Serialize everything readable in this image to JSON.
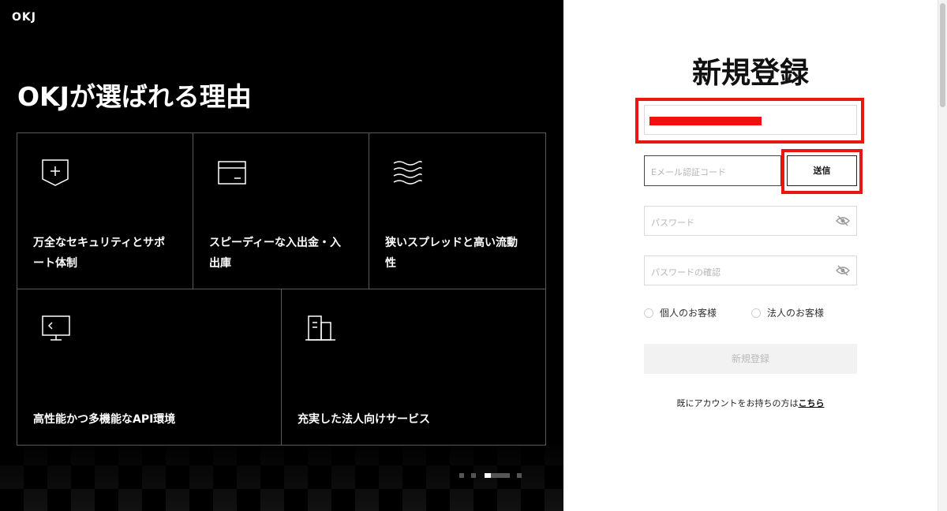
{
  "brand": {
    "logo": "OKJ"
  },
  "hero": {
    "title": "OKJが選ばれる理由",
    "features": [
      {
        "icon": "shield-plus-icon",
        "label_line1": "万全なセキュリティとサポ",
        "label_line2": "ート体制"
      },
      {
        "icon": "card-icon",
        "label_line1": "スピーディーな入出金・入",
        "label_line2": "出庫"
      },
      {
        "icon": "waves-icon",
        "label_line1": "狭いスプレッドと高い流動",
        "label_line2": "性"
      },
      {
        "icon": "monitor-icon",
        "label_line1": "高性能かつ多機能なAPI環境",
        "label_line2": ""
      },
      {
        "icon": "buildings-icon",
        "label_line1": "充実した法人向けサービス",
        "label_line2": ""
      }
    ],
    "carousel": {
      "count": 4,
      "active_index": 2
    }
  },
  "form": {
    "title": "新規登録",
    "email_value": "",
    "code_placeholder": "Eメール認証コード",
    "send_label": "送信",
    "password_placeholder": "パスワード",
    "password_confirm_placeholder": "パスワードの確認",
    "radio_individual": "個人のお客様",
    "radio_corporate": "法人のお客様",
    "submit_label": "新規登録",
    "login_prompt": "既にアカウントをお持ちの方は",
    "login_link": "こちら"
  },
  "colors": {
    "highlight": "#e8170f",
    "left_bg": "#000000"
  }
}
